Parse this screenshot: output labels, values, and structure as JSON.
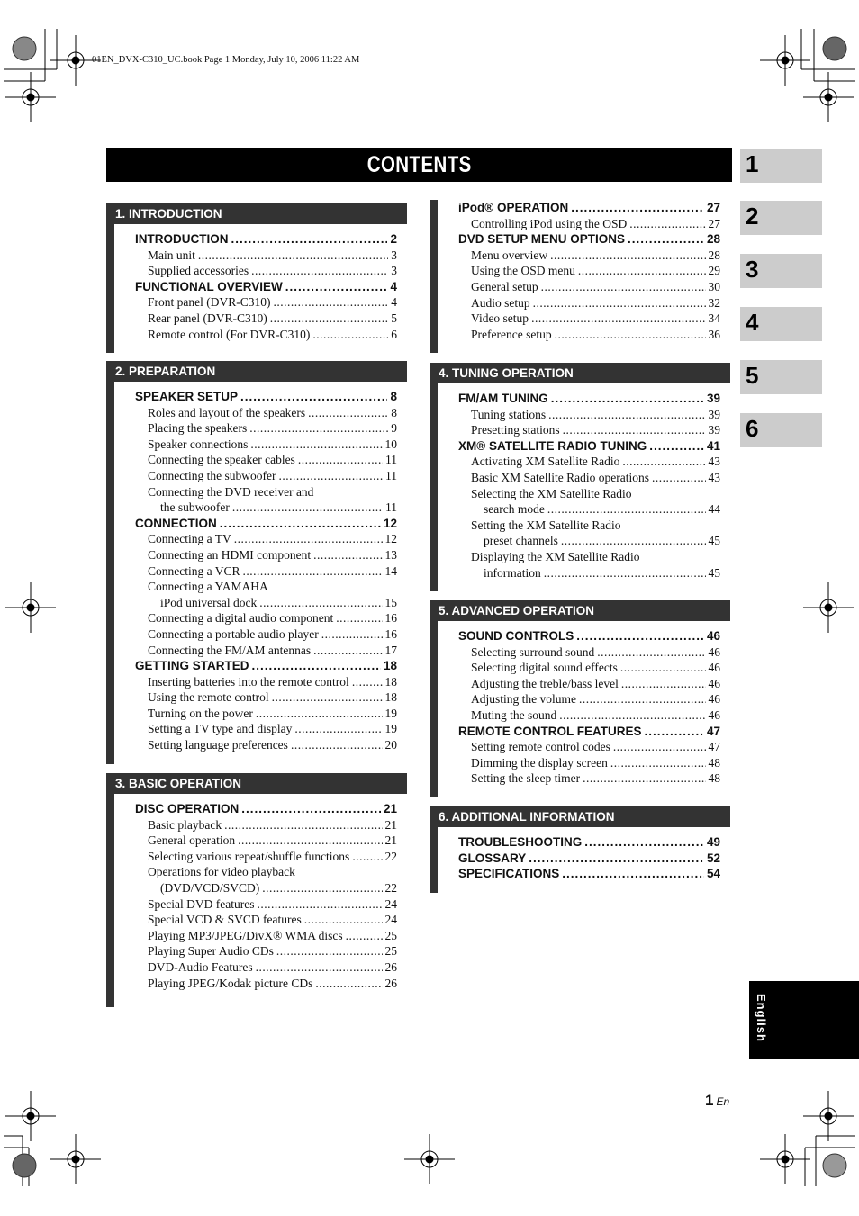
{
  "header_note": "01EN_DVX-C310_UC.book  Page 1  Monday, July 10, 2006  11:22 AM",
  "title": "CONTENTS",
  "chapter_tabs": [
    "1",
    "2",
    "3",
    "4",
    "5",
    "6"
  ],
  "language_tab": "English",
  "page_number": "1",
  "page_suffix": "En",
  "sections": [
    {
      "heading": "1. INTRODUCTION",
      "entries": [
        {
          "type": "major",
          "label": "INTRODUCTION",
          "page": "2"
        },
        {
          "type": "minor",
          "label": "Main unit",
          "page": "3"
        },
        {
          "type": "minor",
          "label": "Supplied accessories",
          "page": "3"
        },
        {
          "type": "major",
          "label": "FUNCTIONAL OVERVIEW",
          "page": "4"
        },
        {
          "type": "minor",
          "label": "Front panel (DVR-C310)",
          "page": "4"
        },
        {
          "type": "minor",
          "label": "Rear panel (DVR-C310)",
          "page": "5"
        },
        {
          "type": "minor",
          "label": "Remote control (For DVR-C310)",
          "page": "6"
        }
      ]
    },
    {
      "heading": "2. PREPARATION",
      "entries": [
        {
          "type": "major",
          "label": "SPEAKER SETUP",
          "page": "8"
        },
        {
          "type": "minor",
          "label": "Roles and layout of the speakers",
          "page": "8"
        },
        {
          "type": "minor",
          "label": "Placing the speakers",
          "page": "9"
        },
        {
          "type": "minor",
          "label": "Speaker connections",
          "page": "10"
        },
        {
          "type": "minor",
          "label": "Connecting the speaker cables",
          "page": "11"
        },
        {
          "type": "minor",
          "label": "Connecting the subwoofer",
          "page": "11"
        },
        {
          "type": "minor",
          "label": "Connecting the DVD receiver and",
          "page": ""
        },
        {
          "type": "cont",
          "label": "the subwoofer",
          "page": "11"
        },
        {
          "type": "major",
          "label": "CONNECTION",
          "page": "12"
        },
        {
          "type": "minor",
          "label": "Connecting a TV",
          "page": "12"
        },
        {
          "type": "minor",
          "label": "Connecting an HDMI component",
          "page": "13"
        },
        {
          "type": "minor",
          "label": "Connecting a VCR",
          "page": "14"
        },
        {
          "type": "minor",
          "label": "Connecting a YAMAHA",
          "page": ""
        },
        {
          "type": "cont",
          "label": "iPod universal dock",
          "page": "15"
        },
        {
          "type": "minor",
          "label": "Connecting a digital audio component",
          "page": "16"
        },
        {
          "type": "minor",
          "label": "Connecting a portable audio player",
          "page": "16"
        },
        {
          "type": "minor",
          "label": "Connecting the FM/AM antennas",
          "page": "17"
        },
        {
          "type": "major",
          "label": "GETTING STARTED",
          "page": "18"
        },
        {
          "type": "minor",
          "label": "Inserting batteries into the remote control",
          "page": "18"
        },
        {
          "type": "minor",
          "label": "Using the remote control",
          "page": "18"
        },
        {
          "type": "minor",
          "label": "Turning on the power",
          "page": "19"
        },
        {
          "type": "minor",
          "label": "Setting a TV type and display",
          "page": "19"
        },
        {
          "type": "minor",
          "label": "Setting language preferences",
          "page": "20"
        }
      ]
    },
    {
      "heading": "3. BASIC OPERATION",
      "entries": [
        {
          "type": "major",
          "label": "DISC OPERATION",
          "page": "21"
        },
        {
          "type": "minor",
          "label": "Basic playback",
          "page": "21"
        },
        {
          "type": "minor",
          "label": "General operation",
          "page": "21"
        },
        {
          "type": "minor",
          "label": "Selecting various repeat/shuffle functions",
          "page": "22"
        },
        {
          "type": "minor",
          "label": "Operations for video playback",
          "page": ""
        },
        {
          "type": "cont",
          "label": "(DVD/VCD/SVCD)",
          "page": "22"
        },
        {
          "type": "minor",
          "label": "Special DVD features",
          "page": "24"
        },
        {
          "type": "minor",
          "label": "Special VCD & SVCD features",
          "page": "24"
        },
        {
          "type": "minor",
          "label": "Playing MP3/JPEG/DivX® WMA discs",
          "page": "25"
        },
        {
          "type": "minor",
          "label": "Playing Super Audio CDs",
          "page": "25"
        },
        {
          "type": "minor",
          "label": "DVD-Audio Features",
          "page": "26"
        },
        {
          "type": "minor",
          "label": "Playing JPEG/Kodak picture CDs",
          "page": "26"
        }
      ]
    },
    {
      "heading": "",
      "entries": [
        {
          "type": "major",
          "label": "iPod® OPERATION",
          "page": "27"
        },
        {
          "type": "minor",
          "label": "Controlling iPod using the OSD",
          "page": "27"
        },
        {
          "type": "major",
          "label": "DVD SETUP MENU OPTIONS",
          "page": "28"
        },
        {
          "type": "minor",
          "label": "Menu overview",
          "page": "28"
        },
        {
          "type": "minor",
          "label": "Using the OSD menu",
          "page": "29"
        },
        {
          "type": "minor",
          "label": "General setup",
          "page": "30"
        },
        {
          "type": "minor",
          "label": "Audio setup",
          "page": "32"
        },
        {
          "type": "minor",
          "label": "Video setup",
          "page": "34"
        },
        {
          "type": "minor",
          "label": "Preference setup",
          "page": "36"
        }
      ]
    },
    {
      "heading": "4. TUNING OPERATION",
      "entries": [
        {
          "type": "major",
          "label": "FM/AM TUNING",
          "page": "39"
        },
        {
          "type": "minor",
          "label": "Tuning stations",
          "page": "39"
        },
        {
          "type": "minor",
          "label": "Presetting stations",
          "page": "39"
        },
        {
          "type": "major",
          "label": "XM® SATELLITE RADIO TUNING",
          "page": "41"
        },
        {
          "type": "minor",
          "label": "Activating XM Satellite Radio",
          "page": "43"
        },
        {
          "type": "minor",
          "label": "Basic XM Satellite Radio operations",
          "page": "43"
        },
        {
          "type": "minor",
          "label": "Selecting the XM Satellite Radio",
          "page": ""
        },
        {
          "type": "cont",
          "label": "search mode",
          "page": "44"
        },
        {
          "type": "minor",
          "label": "Setting the XM Satellite Radio",
          "page": ""
        },
        {
          "type": "cont",
          "label": "preset channels",
          "page": "45"
        },
        {
          "type": "minor",
          "label": "Displaying the XM Satellite Radio",
          "page": ""
        },
        {
          "type": "cont",
          "label": "information",
          "page": "45"
        }
      ]
    },
    {
      "heading": "5. ADVANCED OPERATION",
      "entries": [
        {
          "type": "major",
          "label": "SOUND CONTROLS",
          "page": "46"
        },
        {
          "type": "minor",
          "label": "Selecting surround sound",
          "page": "46"
        },
        {
          "type": "minor",
          "label": "Selecting digital sound effects",
          "page": "46"
        },
        {
          "type": "minor",
          "label": "Adjusting the treble/bass level",
          "page": "46"
        },
        {
          "type": "minor",
          "label": "Adjusting the volume",
          "page": "46"
        },
        {
          "type": "minor",
          "label": "Muting the sound",
          "page": "46"
        },
        {
          "type": "major",
          "label": "REMOTE CONTROL FEATURES",
          "page": "47"
        },
        {
          "type": "minor",
          "label": "Setting remote control codes",
          "page": "47"
        },
        {
          "type": "minor",
          "label": "Dimming the display screen",
          "page": "48"
        },
        {
          "type": "minor",
          "label": "Setting the sleep timer",
          "page": "48"
        }
      ]
    },
    {
      "heading": "6. ADDITIONAL INFORMATION",
      "entries": [
        {
          "type": "major",
          "label": "TROUBLESHOOTING",
          "page": "49"
        },
        {
          "type": "major",
          "label": "GLOSSARY",
          "page": "52"
        },
        {
          "type": "major",
          "label": "SPECIFICATIONS",
          "page": "54"
        }
      ]
    }
  ]
}
